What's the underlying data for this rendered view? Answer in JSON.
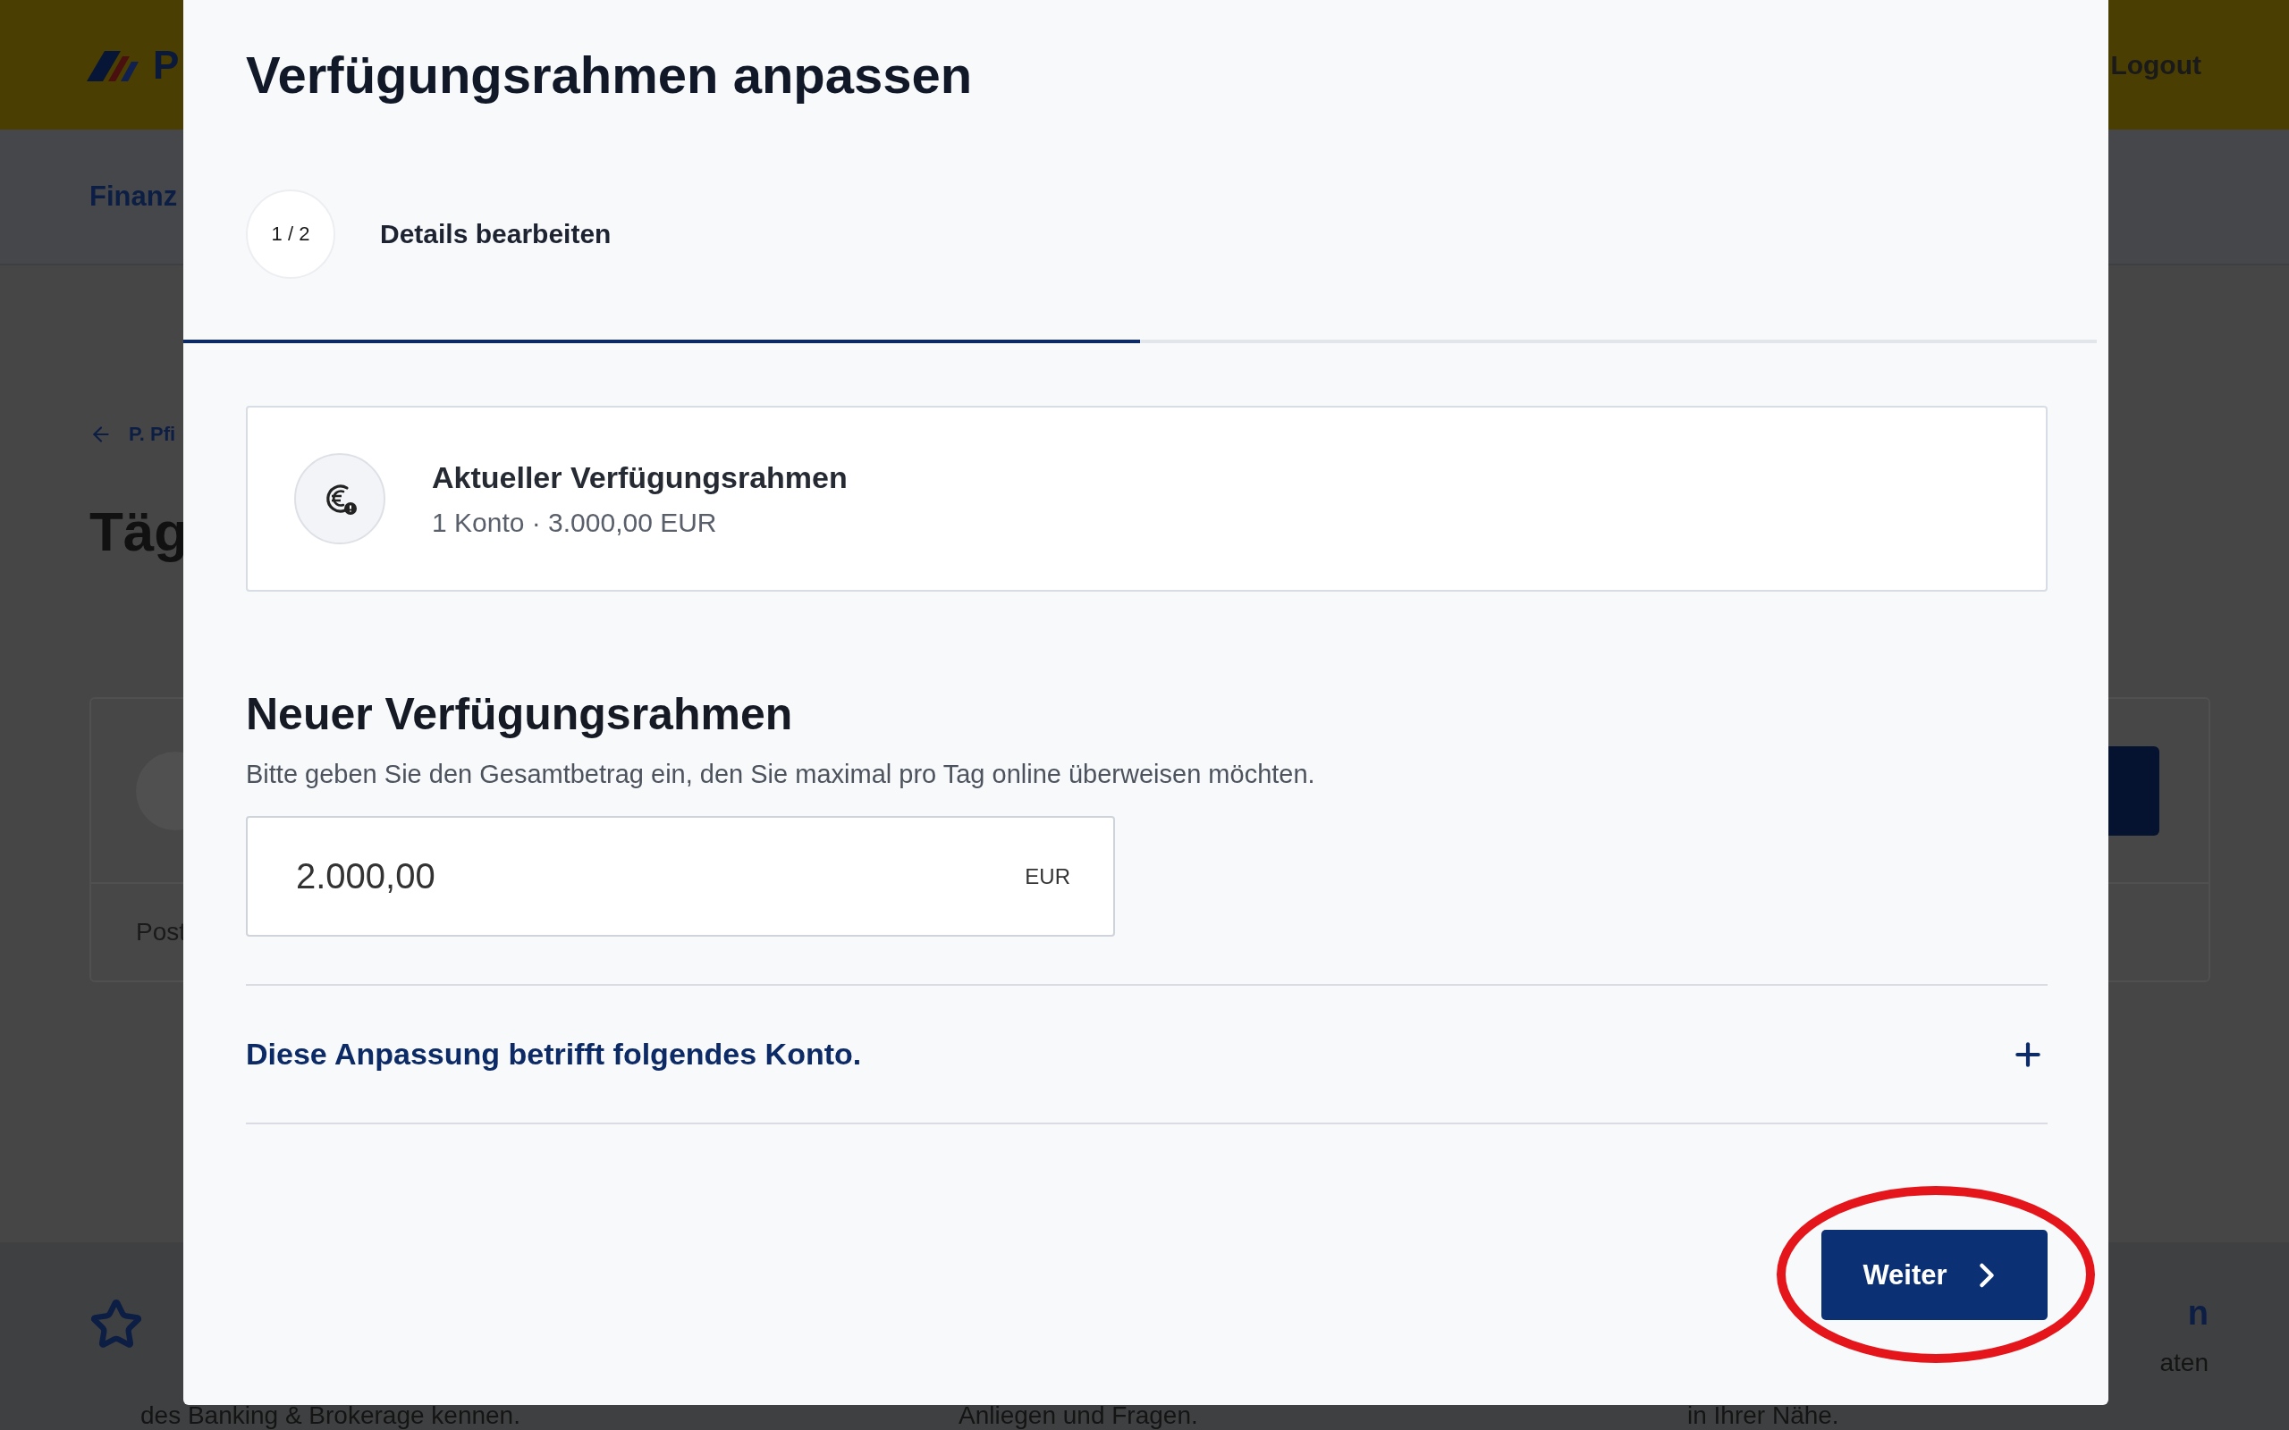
{
  "background": {
    "brand": "P",
    "logout": "Logout",
    "nav_item": "Finanz",
    "back_link": "P. Pfi",
    "page_title": "Täg",
    "card_text": "Post",
    "footer_heading": "n",
    "footer_line": "aten",
    "footer_texts": [
      "des Banking & Brokerage kennen.",
      "Anliegen und Fragen.",
      "in Ihrer Nähe."
    ]
  },
  "dialog": {
    "title": "Verfügungsrahmen anpassen",
    "step": {
      "counter": "1 / 2",
      "label": "Details bearbeiten",
      "level": 0.5
    },
    "current": {
      "title": "Aktueller Verfügungsrahmen",
      "detail": "1 Konto · 3.000,00 EUR"
    },
    "section_title": "Neuer Verfügungsrahmen",
    "hint": "Bitte geben Sie den Gesamtbetrag ein, den Sie maximal pro Tag online überweisen möchten.",
    "amount": {
      "value": "2.000,00",
      "currency": "EUR"
    },
    "accordion": {
      "label": "Diese Anpassung betrifft folgendes Konto.",
      "expanded": false
    },
    "next_button": "Weiter"
  }
}
